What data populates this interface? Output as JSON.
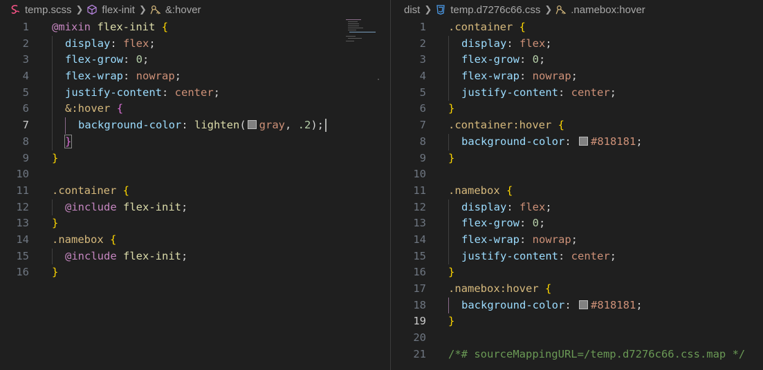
{
  "left": {
    "breadcrumb": {
      "file": "temp.scss",
      "mixin": "flex-init",
      "selector": "&:hover"
    },
    "lines": [
      {
        "n": "1",
        "indent": 0,
        "tokens": [
          [
            "at",
            "@mixin"
          ],
          [
            "plain",
            " "
          ],
          [
            "name",
            "flex-init"
          ],
          [
            "plain",
            " "
          ],
          [
            "b1",
            "{"
          ]
        ]
      },
      {
        "n": "2",
        "indent": 1,
        "tokens": [
          [
            "prop",
            "display"
          ],
          [
            "plain",
            ": "
          ],
          [
            "val",
            "flex"
          ],
          [
            "plain",
            ";"
          ]
        ]
      },
      {
        "n": "3",
        "indent": 1,
        "tokens": [
          [
            "prop",
            "flex-grow"
          ],
          [
            "plain",
            ": "
          ],
          [
            "num",
            "0"
          ],
          [
            "plain",
            ";"
          ]
        ]
      },
      {
        "n": "4",
        "indent": 1,
        "tokens": [
          [
            "prop",
            "flex-wrap"
          ],
          [
            "plain",
            ": "
          ],
          [
            "val",
            "nowrap"
          ],
          [
            "plain",
            ";"
          ]
        ]
      },
      {
        "n": "5",
        "indent": 1,
        "tokens": [
          [
            "prop",
            "justify-content"
          ],
          [
            "plain",
            ": "
          ],
          [
            "val",
            "center"
          ],
          [
            "plain",
            ";"
          ]
        ]
      },
      {
        "n": "6",
        "indent": 1,
        "tokens": [
          [
            "sel",
            "&"
          ],
          [
            "sel",
            ":hover"
          ],
          [
            "plain",
            " "
          ],
          [
            "b2",
            "{"
          ]
        ]
      },
      {
        "n": "7",
        "indent": 2,
        "active": true,
        "tokens": [
          [
            "prop",
            "background-color"
          ],
          [
            "plain",
            ": "
          ],
          [
            "fn",
            "lighten"
          ],
          [
            "plain",
            "("
          ],
          [
            "swatch",
            "#808080"
          ],
          [
            "val",
            "gray"
          ],
          [
            "plain",
            ", "
          ],
          [
            "num",
            ".2"
          ],
          [
            "plain",
            ");"
          ],
          [
            "cursor",
            ""
          ]
        ]
      },
      {
        "n": "8",
        "indent": 1,
        "tokens": [
          [
            "b2box",
            "}"
          ]
        ]
      },
      {
        "n": "9",
        "indent": 0,
        "tokens": [
          [
            "b1",
            "}"
          ]
        ]
      },
      {
        "n": "10",
        "indent": 0,
        "tokens": []
      },
      {
        "n": "11",
        "indent": 0,
        "tokens": [
          [
            "sel",
            ".container"
          ],
          [
            "plain",
            " "
          ],
          [
            "b1",
            "{"
          ]
        ]
      },
      {
        "n": "12",
        "indent": 1,
        "tokens": [
          [
            "at",
            "@include"
          ],
          [
            "plain",
            " "
          ],
          [
            "name",
            "flex-init"
          ],
          [
            "plain",
            ";"
          ]
        ]
      },
      {
        "n": "13",
        "indent": 0,
        "tokens": [
          [
            "b1",
            "}"
          ]
        ]
      },
      {
        "n": "14",
        "indent": 0,
        "tokens": [
          [
            "sel",
            ".namebox"
          ],
          [
            "plain",
            " "
          ],
          [
            "b1",
            "{"
          ]
        ]
      },
      {
        "n": "15",
        "indent": 1,
        "tokens": [
          [
            "at",
            "@include"
          ],
          [
            "plain",
            " "
          ],
          [
            "name",
            "flex-init"
          ],
          [
            "plain",
            ";"
          ]
        ]
      },
      {
        "n": "16",
        "indent": 0,
        "tokens": [
          [
            "b1",
            "}"
          ]
        ]
      }
    ]
  },
  "right": {
    "breadcrumb": {
      "folder": "dist",
      "file": "temp.d7276c66.css",
      "selector": ".namebox:hover"
    },
    "lines": [
      {
        "n": "1",
        "indent": 0,
        "tokens": [
          [
            "sel",
            ".container"
          ],
          [
            "plain",
            " "
          ],
          [
            "b1",
            "{"
          ]
        ]
      },
      {
        "n": "2",
        "indent": 1,
        "tokens": [
          [
            "prop",
            "display"
          ],
          [
            "plain",
            ": "
          ],
          [
            "val",
            "flex"
          ],
          [
            "plain",
            ";"
          ]
        ]
      },
      {
        "n": "3",
        "indent": 1,
        "tokens": [
          [
            "prop",
            "flex-grow"
          ],
          [
            "plain",
            ": "
          ],
          [
            "num",
            "0"
          ],
          [
            "plain",
            ";"
          ]
        ]
      },
      {
        "n": "4",
        "indent": 1,
        "tokens": [
          [
            "prop",
            "flex-wrap"
          ],
          [
            "plain",
            ": "
          ],
          [
            "val",
            "nowrap"
          ],
          [
            "plain",
            ";"
          ]
        ]
      },
      {
        "n": "5",
        "indent": 1,
        "tokens": [
          [
            "prop",
            "justify-content"
          ],
          [
            "plain",
            ": "
          ],
          [
            "val",
            "center"
          ],
          [
            "plain",
            ";"
          ]
        ]
      },
      {
        "n": "6",
        "indent": 0,
        "tokens": [
          [
            "b1",
            "}"
          ]
        ]
      },
      {
        "n": "7",
        "indent": 0,
        "tokens": [
          [
            "sel",
            ".container:hover"
          ],
          [
            "plain",
            " "
          ],
          [
            "b1",
            "{"
          ]
        ]
      },
      {
        "n": "8",
        "indent": 1,
        "tokens": [
          [
            "prop",
            "background-color"
          ],
          [
            "plain",
            ": "
          ],
          [
            "swatch",
            "#818181"
          ],
          [
            "val",
            "#818181"
          ],
          [
            "plain",
            ";"
          ]
        ]
      },
      {
        "n": "9",
        "indent": 0,
        "tokens": [
          [
            "b1",
            "}"
          ]
        ]
      },
      {
        "n": "10",
        "indent": 0,
        "tokens": []
      },
      {
        "n": "11",
        "indent": 0,
        "tokens": [
          [
            "sel",
            ".namebox"
          ],
          [
            "plain",
            " "
          ],
          [
            "b1",
            "{"
          ]
        ]
      },
      {
        "n": "12",
        "indent": 1,
        "tokens": [
          [
            "prop",
            "display"
          ],
          [
            "plain",
            ": "
          ],
          [
            "val",
            "flex"
          ],
          [
            "plain",
            ";"
          ]
        ]
      },
      {
        "n": "13",
        "indent": 1,
        "tokens": [
          [
            "prop",
            "flex-grow"
          ],
          [
            "plain",
            ": "
          ],
          [
            "num",
            "0"
          ],
          [
            "plain",
            ";"
          ]
        ]
      },
      {
        "n": "14",
        "indent": 1,
        "tokens": [
          [
            "prop",
            "flex-wrap"
          ],
          [
            "plain",
            ": "
          ],
          [
            "val",
            "nowrap"
          ],
          [
            "plain",
            ";"
          ]
        ]
      },
      {
        "n": "15",
        "indent": 1,
        "tokens": [
          [
            "prop",
            "justify-content"
          ],
          [
            "plain",
            ": "
          ],
          [
            "val",
            "center"
          ],
          [
            "plain",
            ";"
          ]
        ]
      },
      {
        "n": "16",
        "indent": 0,
        "tokens": [
          [
            "b1",
            "}"
          ]
        ]
      },
      {
        "n": "17",
        "indent": 0,
        "tokens": [
          [
            "sel",
            ".namebox:hover"
          ],
          [
            "plain",
            " "
          ],
          [
            "b1",
            "{"
          ]
        ]
      },
      {
        "n": "18",
        "indent": 1,
        "activeGuide": true,
        "tokens": [
          [
            "prop",
            "background-color"
          ],
          [
            "plain",
            ": "
          ],
          [
            "swatch",
            "#818181"
          ],
          [
            "val",
            "#818181"
          ],
          [
            "plain",
            ";"
          ]
        ]
      },
      {
        "n": "19",
        "indent": 0,
        "active": true,
        "tokens": [
          [
            "b1",
            "}"
          ]
        ]
      },
      {
        "n": "20",
        "indent": 0,
        "tokens": []
      },
      {
        "n": "21",
        "indent": 0,
        "tokens": [
          [
            "com",
            "/*# sourceMappingURL=/temp.d7276c66.css.map */"
          ]
        ]
      }
    ]
  },
  "colors": {
    "background": "#1f1f1f",
    "scss_icon": "#f55385",
    "css_icon": "#4b9ae8",
    "symbol_icon": "#b180d7",
    "selector_icon": "#d7ba7d"
  }
}
